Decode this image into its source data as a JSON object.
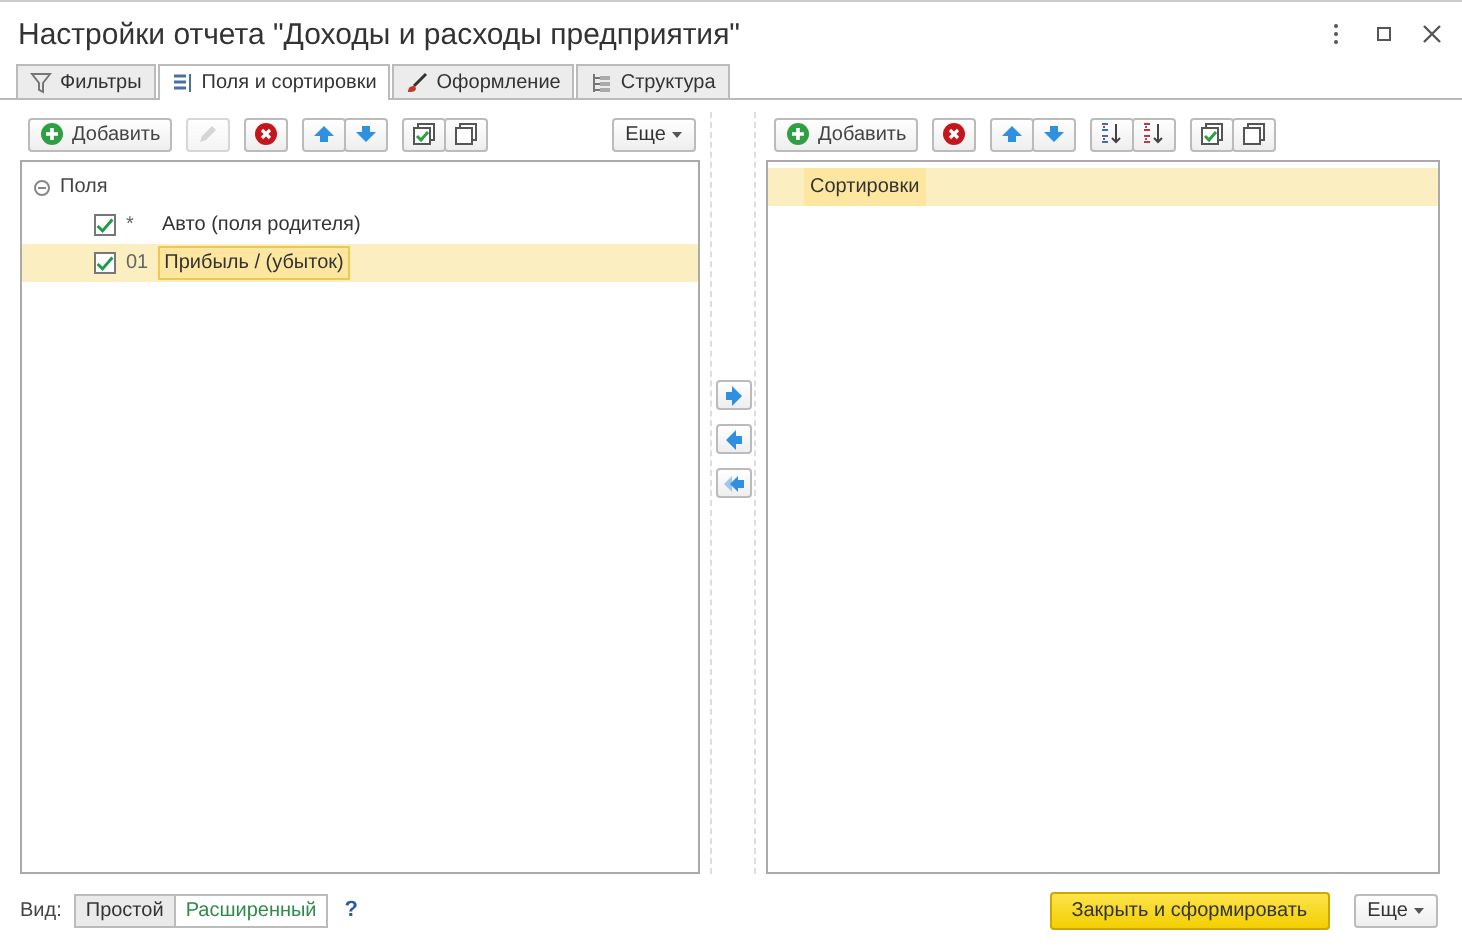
{
  "window": {
    "title": "Настройки отчета \"Доходы и расходы предприятия\""
  },
  "tabs": [
    {
      "label": "Фильтры",
      "kind": "filter",
      "selected": false
    },
    {
      "label": "Поля и сортировки",
      "kind": "fields",
      "selected": true
    },
    {
      "label": "Оформление",
      "kind": "brush",
      "selected": false
    },
    {
      "label": "Структура",
      "kind": "structure",
      "selected": false
    }
  ],
  "fields_panel": {
    "toolbar": [
      {
        "buttons": [
          {
            "kind": "add",
            "label": "Добавить",
            "disabled": false
          }
        ]
      },
      {
        "buttons": [
          {
            "kind": "edit",
            "disabled": true
          }
        ]
      },
      {
        "buttons": [
          {
            "kind": "delete",
            "disabled": false
          }
        ]
      },
      {
        "buttons": [
          {
            "kind": "up",
            "disabled": false
          },
          {
            "kind": "down",
            "disabled": false
          }
        ]
      },
      {
        "buttons": [
          {
            "kind": "check_all",
            "disabled": false
          },
          {
            "kind": "uncheck_all",
            "disabled": false
          }
        ]
      }
    ],
    "more": "Еще",
    "tree": {
      "label": "Поля",
      "expanded": true,
      "children": [
        {
          "checked": true,
          "marker": "*",
          "label": "Авто (поля родителя)",
          "selected": false
        },
        {
          "checked": true,
          "marker": "01",
          "label": "Прибыль / (убыток)",
          "selected": true
        }
      ]
    }
  },
  "move_buttons": [
    {
      "kind": "right"
    },
    {
      "kind": "left"
    },
    {
      "kind": "left_all"
    }
  ],
  "sort_panel": {
    "toolbar": [
      {
        "buttons": [
          {
            "kind": "add",
            "label": "Добавить",
            "disabled": false
          }
        ]
      },
      {
        "buttons": [
          {
            "kind": "delete",
            "disabled": false
          }
        ]
      },
      {
        "buttons": [
          {
            "kind": "up",
            "disabled": false
          },
          {
            "kind": "down",
            "disabled": false
          }
        ]
      },
      {
        "buttons": [
          {
            "kind": "sort_asc",
            "disabled": false
          },
          {
            "kind": "sort_desc",
            "disabled": false
          }
        ]
      },
      {
        "buttons": [
          {
            "kind": "check_all",
            "disabled": false
          },
          {
            "kind": "uncheck_all",
            "disabled": false
          }
        ]
      }
    ],
    "items": [
      {
        "label": "Сортировки",
        "selected": true
      }
    ]
  },
  "footer": {
    "view_label": "Вид:",
    "view_options": [
      {
        "label": "Простой",
        "selected": false
      },
      {
        "label": "Расширенный",
        "selected": true
      }
    ],
    "help": "?",
    "primary": "Закрыть и сформировать",
    "more": "Еще"
  }
}
